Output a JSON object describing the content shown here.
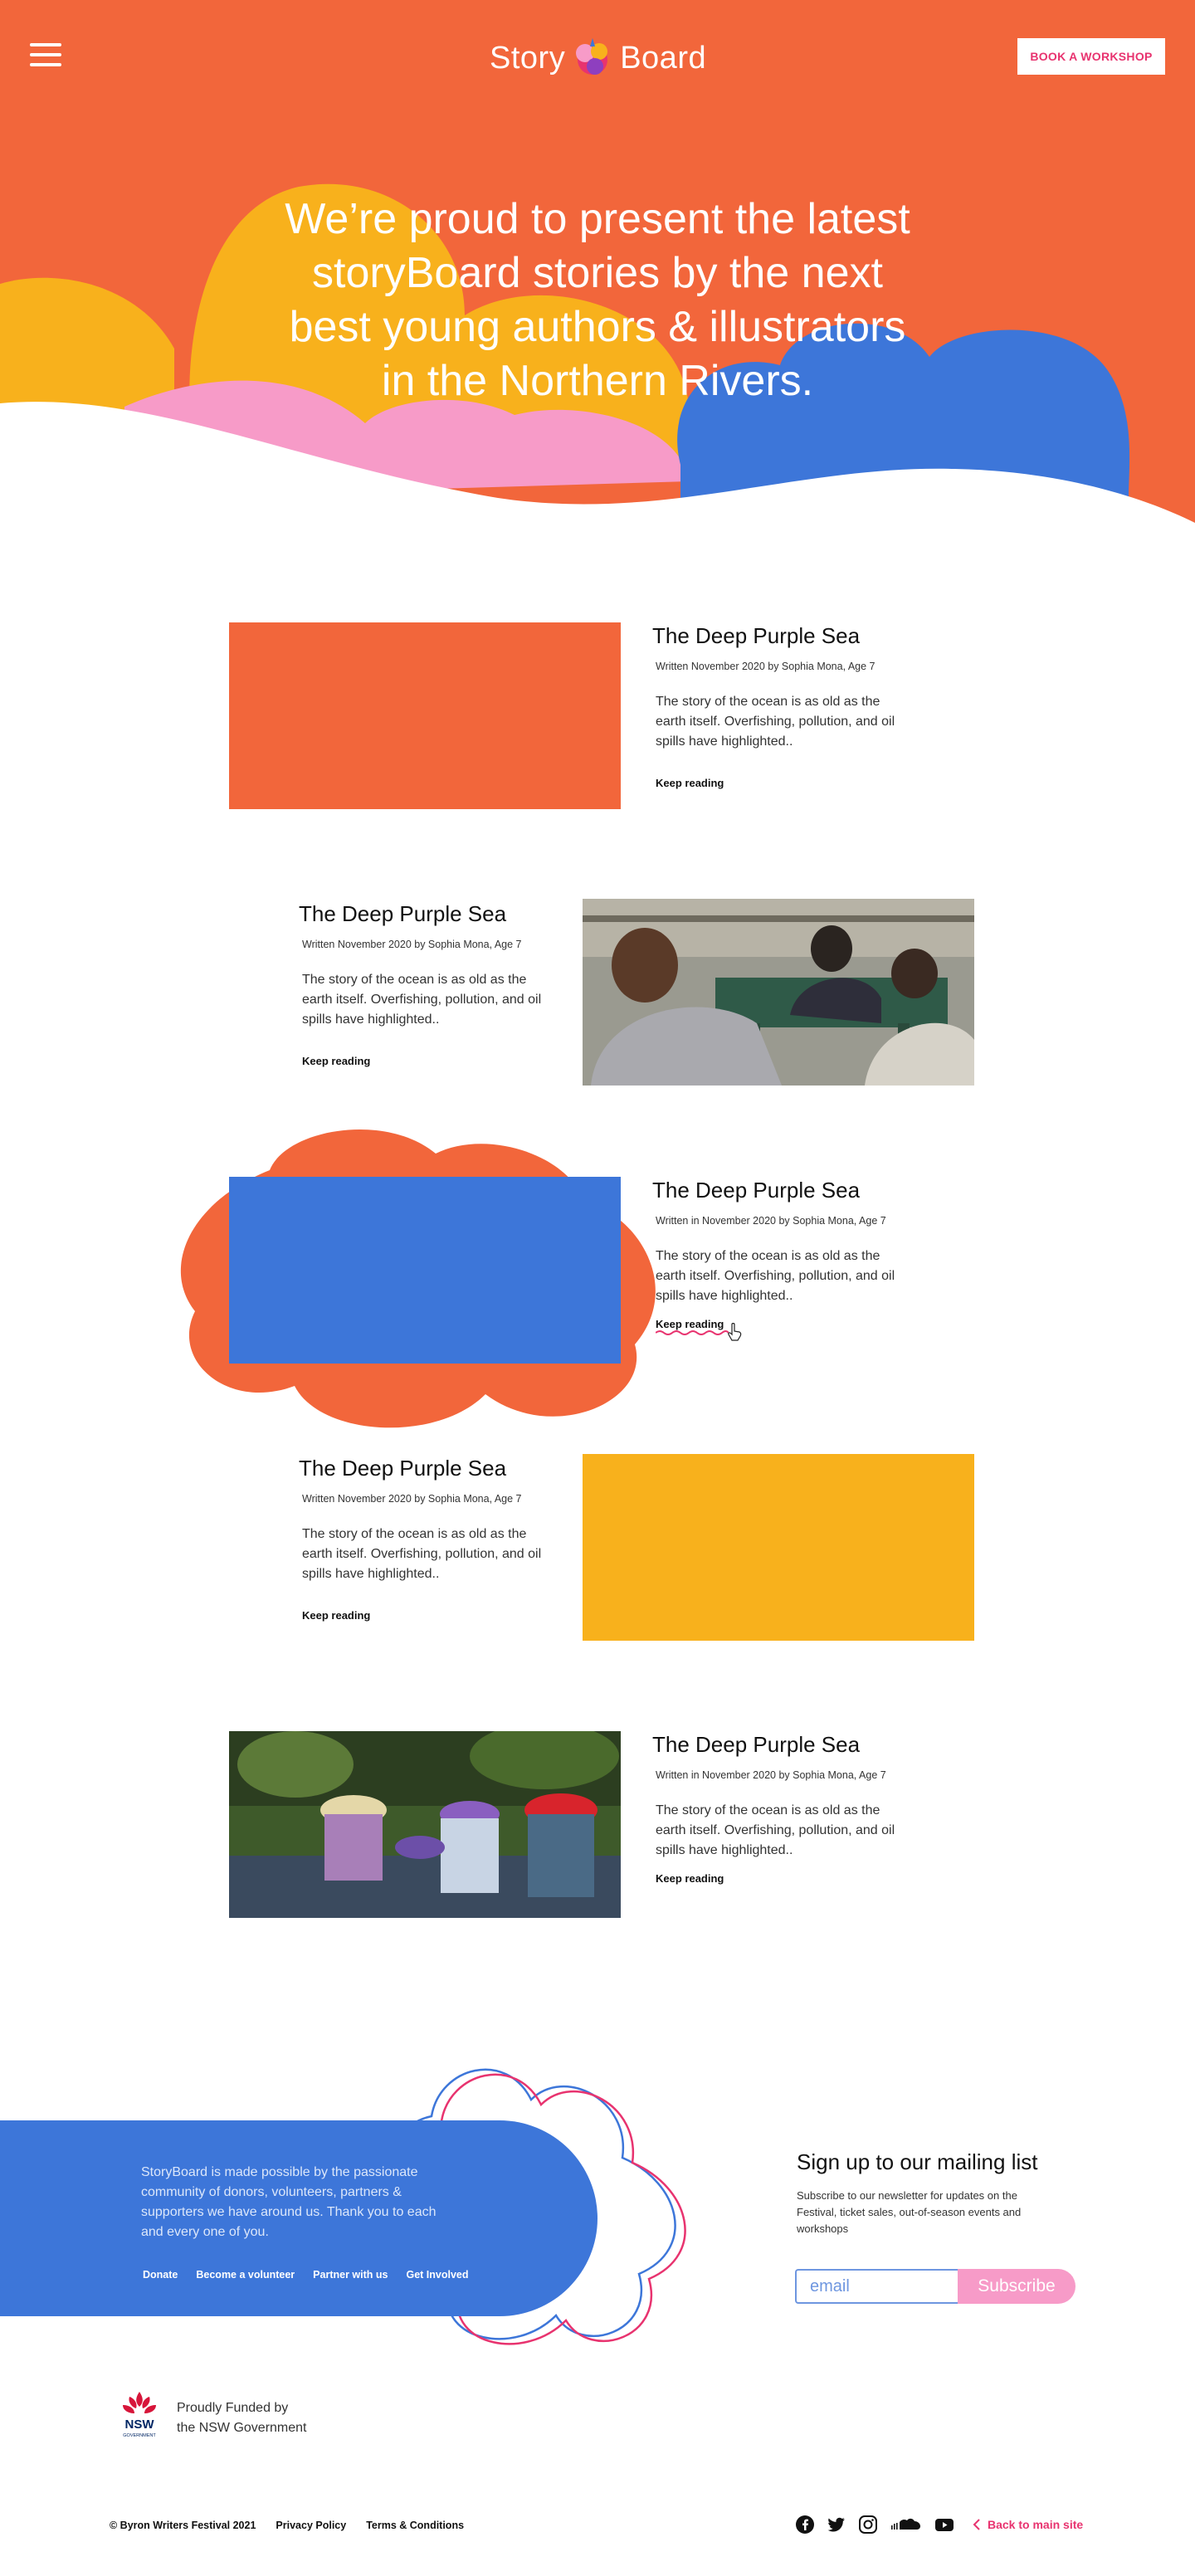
{
  "header": {
    "logo_left": "Story",
    "logo_right": "Board",
    "book_label": "BOOK A WORKSHOP"
  },
  "hero": {
    "line1": "We’re proud to present the latest",
    "line2": "storyBoard stories by the next",
    "line3": "best young authors & illustrators",
    "line4": "in the Northern Rivers."
  },
  "stories": [
    {
      "title": "The Deep Purple Sea",
      "meta": "Written November 2020 by Sophia Mona, Age 7",
      "excerpt": "The story of the ocean is as old as the earth itself. Overfishing, pollution, and oil spills have highlighted..",
      "link": "Keep reading",
      "image": "orange-block"
    },
    {
      "title": "The Deep Purple Sea",
      "meta": "Written November 2020 by Sophia Mona, Age 7",
      "excerpt": "The story of the ocean is as old as the earth itself. Overfishing, pollution, and oil spills have highlighted..",
      "link": "Keep reading",
      "image": "children-writing-photo"
    },
    {
      "title": "The Deep Purple Sea",
      "meta": "Written in November 2020 by Sophia Mona, Age 7",
      "excerpt": "The story of the ocean is as old as the earth itself. Overfishing, pollution, and oil spills have highlighted..",
      "link": "Keep reading",
      "image": "blue-block"
    },
    {
      "title": "The Deep Purple Sea",
      "meta": "Written November 2020 by Sophia Mona, Age 7",
      "excerpt": "The story of the ocean is as old as the earth itself. Overfishing, pollution, and oil spills have highlighted..",
      "link": "Keep reading",
      "image": "yellow-block"
    },
    {
      "title": "The Deep Purple Sea",
      "meta": "Written in November 2020 by Sophia Mona, Age 7",
      "excerpt": "The story of the ocean is as old as the earth itself. Overfishing, pollution, and oil spills have highlighted..",
      "link": "Keep reading",
      "image": "children-hats-photo"
    }
  ],
  "footer": {
    "blurb": "StoryBoard is made possible by the passionate community of donors, volunteers, partners & supporters we have around us. Thank you to each and every one of you.",
    "links": [
      "Donate",
      "Become a volunteer",
      "Partner with us",
      "Get Involved"
    ],
    "mailing_title": "Sign up to our mailing list",
    "mailing_desc": "Subscribe to our newsletter for updates on the Festival, ticket sales, out-of-season events and workshops",
    "email_placeholder": "email",
    "subscribe_label": "Subscribe",
    "funded_line1": "Proudly Funded by",
    "funded_line2": "the NSW Government",
    "nsw_text": "NSW",
    "nsw_sub": "GOVERNMENT",
    "copyright": "© Byron Writers Festival 2021",
    "privacy": "Privacy Policy",
    "terms": "Terms & Conditions",
    "back_label": "Back to main site",
    "social_icons": [
      "facebook-icon",
      "twitter-icon",
      "instagram-icon",
      "soundcloud-icon",
      "youtube-icon"
    ]
  },
  "colors": {
    "orange": "#F2663B",
    "yellow": "#F8B11C",
    "pink": "#F79BC8",
    "blue": "#3D76D9",
    "magenta": "#E8336F"
  }
}
